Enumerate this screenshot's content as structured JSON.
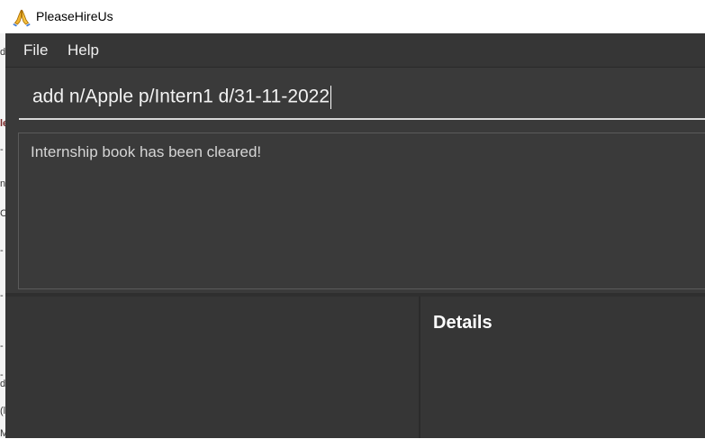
{
  "window": {
    "title": "PleaseHireUs"
  },
  "menu": {
    "items": [
      "File",
      "Help"
    ]
  },
  "command_box": {
    "value": "add n/Apple p/Intern1 d/31-11-2022"
  },
  "result_display": {
    "message": "Internship book has been cleared!"
  },
  "details_panel": {
    "title": "Details"
  },
  "background_fragments": [
    "d",
    "le",
    "-",
    "n",
    "C",
    "-",
    "-",
    "-",
    "-",
    "d",
    "(l",
    "M"
  ],
  "icons": {
    "app": "praying-hands-icon"
  },
  "colors": {
    "window_bg": "#3a3a3a",
    "panel_bg": "#363636",
    "text": "#ffffff",
    "muted_text": "#d5d5d5",
    "underline": "#d7d7d7",
    "icon_skin": "#f2b632"
  }
}
